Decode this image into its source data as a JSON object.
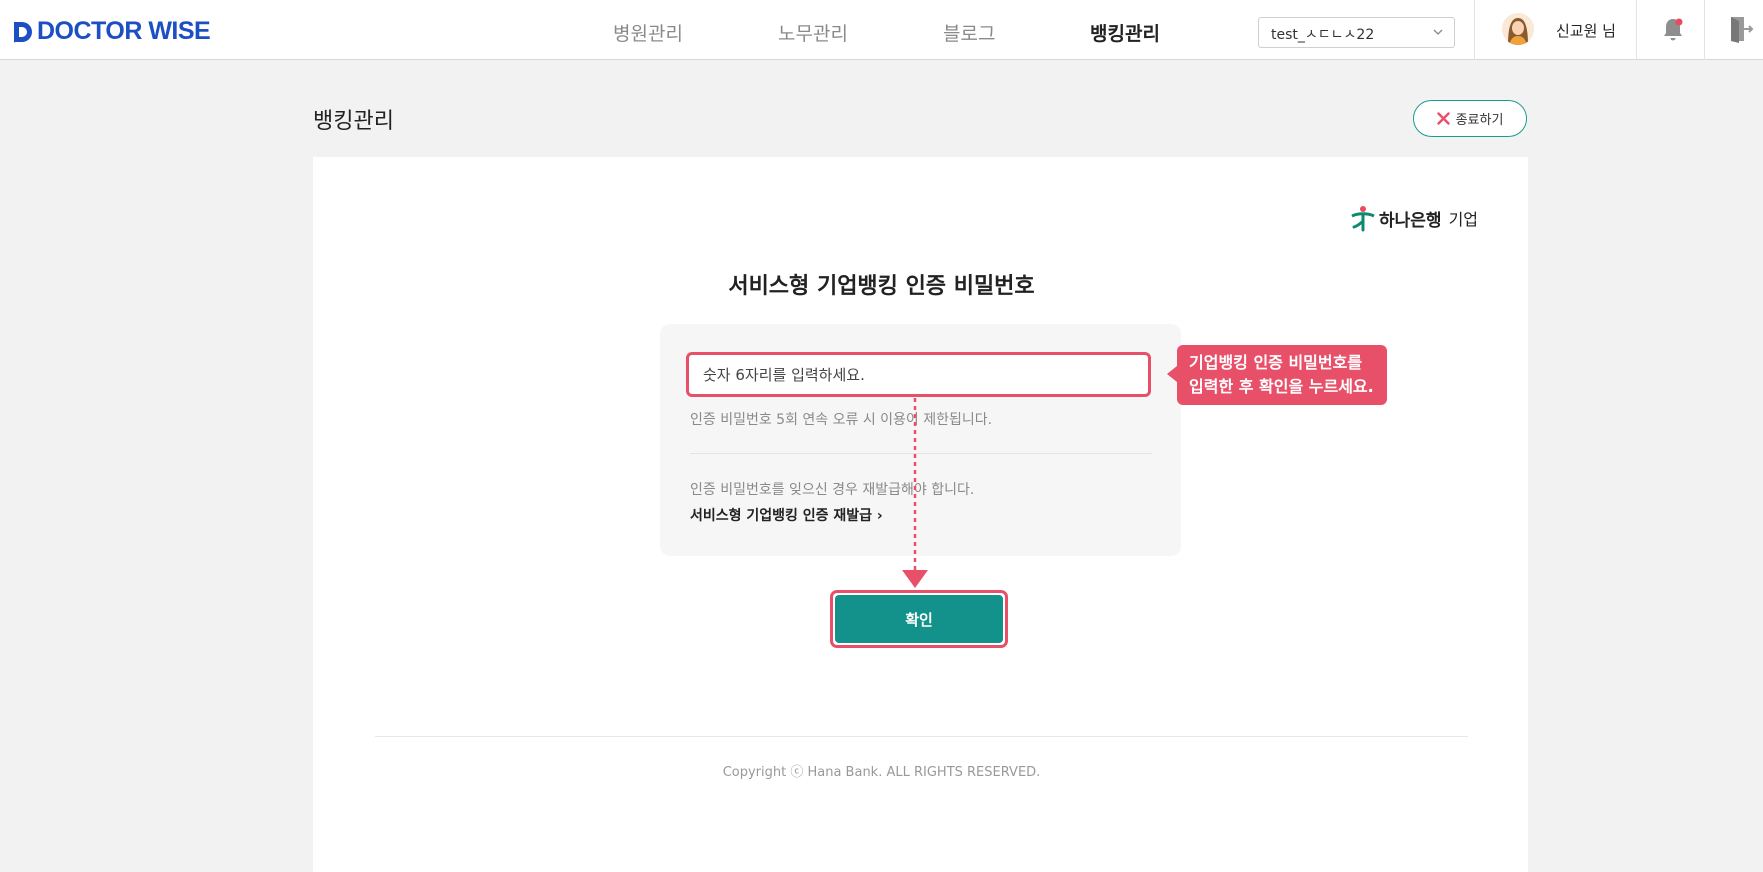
{
  "header": {
    "logo_text": "DOCTOR WISE",
    "nav": [
      {
        "label": "병원관리",
        "active": false
      },
      {
        "label": "노무관리",
        "active": false
      },
      {
        "label": "블로그",
        "active": false
      },
      {
        "label": "뱅킹관리",
        "active": true
      }
    ],
    "site_select": {
      "value": "test_ㅅㄷㄴㅅ22"
    },
    "user": {
      "name": "신교원 님"
    },
    "icons": {
      "bell": "bell-icon",
      "logout": "logout-icon",
      "chevron": "chevron-down-icon"
    }
  },
  "page": {
    "title": "뱅킹관리",
    "close_label": "종료하기"
  },
  "bank": {
    "name": "하나은행",
    "type": "기업"
  },
  "form": {
    "heading": "서비스형 기업뱅킹 인증 비밀번호",
    "input_placeholder": "숫자 6자리를 입력하세요.",
    "hint_error": "인증 비밀번호 5회 연속 오류 시 이용이 제한됩니다.",
    "hint_forgot": "인증 비밀번호를 잊으신 경우 재발급해야 합니다.",
    "reissue_link": "서비스형 기업뱅킹 인증 재발급 ›",
    "confirm_label": "확인"
  },
  "tooltip": {
    "line1": "기업뱅킹 인증 비밀번호를",
    "line2": "입력한 후 확인을 누르세요."
  },
  "footer": {
    "copyright": "Copyright ⓒ Hana Bank. ALL RIGHTS RESERVED."
  },
  "colors": {
    "brand_blue": "#1d4fc4",
    "teal": "#12928a",
    "highlight_pink": "#e8506a"
  }
}
